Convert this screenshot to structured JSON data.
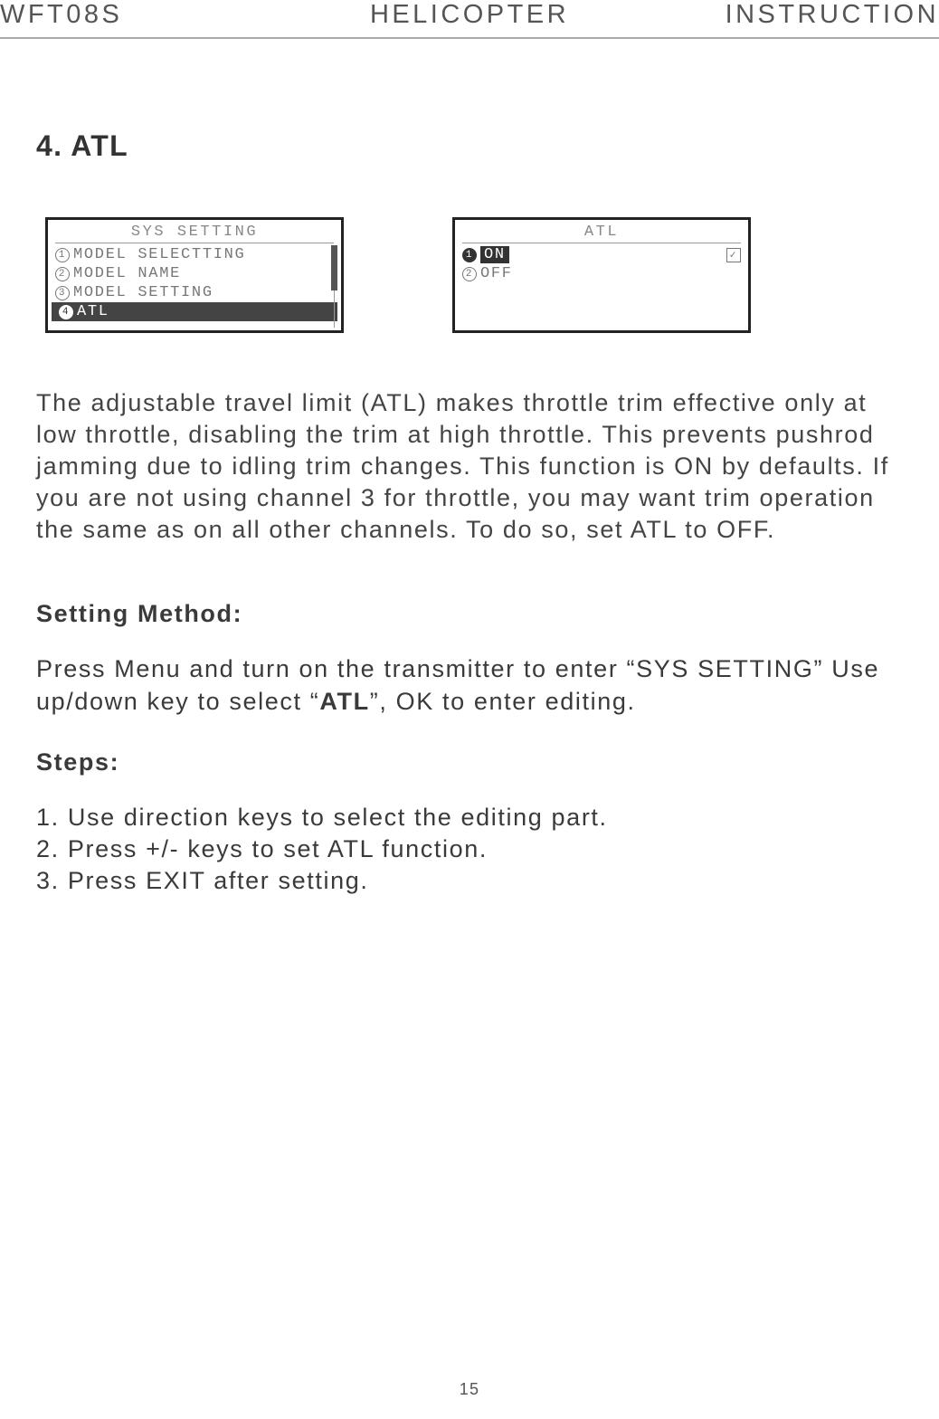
{
  "header": {
    "left": "WFT08S",
    "center": "HELICOPTER",
    "right": "INSTRUCTION"
  },
  "section_title": "4. ATL",
  "lcd1": {
    "title": "SYS SETTING",
    "items": [
      {
        "num": "1",
        "label": "MODEL SELECTTING",
        "selected": false
      },
      {
        "num": "2",
        "label": "MODEL NAME",
        "selected": false
      },
      {
        "num": "3",
        "label": "MODEL SETTING",
        "selected": false
      },
      {
        "num": "4",
        "label": "ATL",
        "selected": true
      }
    ]
  },
  "lcd2": {
    "title": "ATL",
    "items": [
      {
        "num": "1",
        "label": "ON",
        "selected": true,
        "checked": true
      },
      {
        "num": "2",
        "label": "OFF",
        "selected": false,
        "checked": false
      }
    ]
  },
  "description": "The adjustable travel limit (ATL) makes throttle trim effective only at low throttle, disabling the trim at high throttle. This prevents pushrod jamming due to idling trim changes. This function is ON by defaults. If you are not using channel 3 for throttle, you may want trim operation the same as on all other channels. To do so, set ATL to OFF.",
  "setting_method_head": "Setting Method:",
  "setting_method_pre": "Press Menu and turn on the transmitter to enter “SYS SETTING” Use up/down key to select “",
  "setting_method_bold": "ATL",
  "setting_method_post": "”, OK to enter editing.",
  "steps_head": "Steps:",
  "steps": [
    "1. Use direction keys to select the editing part.",
    "2. Press +/- keys to set ATL function.",
    "3. Press EXIT after setting."
  ],
  "page_number": "15"
}
